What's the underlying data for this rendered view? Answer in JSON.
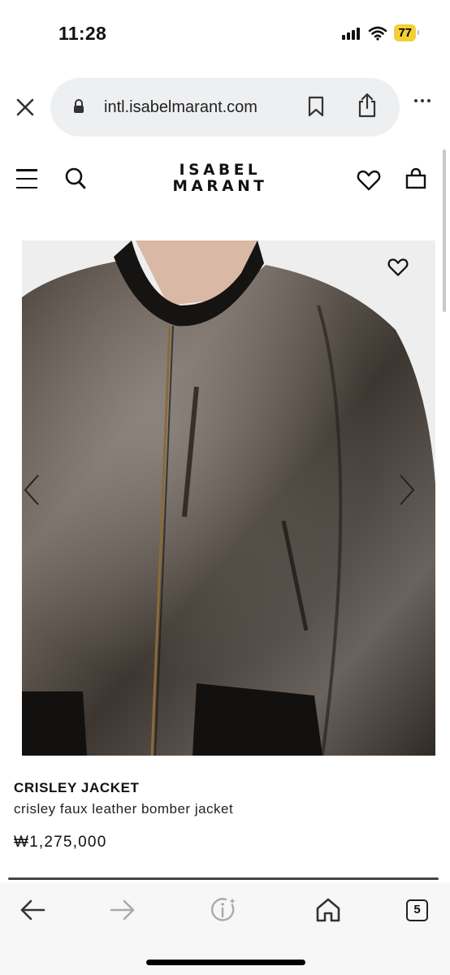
{
  "status_bar": {
    "time": "11:28",
    "battery": "77"
  },
  "browser": {
    "url": "intl.isabelmarant.com",
    "tab_count": "5"
  },
  "site": {
    "logo_line1": "ISABEL",
    "logo_line2": "MARANT"
  },
  "product": {
    "name": "CRISLEY JACKET",
    "description": "crisley faux leather bomber jacket",
    "price": "₩1,275,000"
  },
  "icons": [
    "close-icon",
    "lock-icon",
    "bookmark-icon",
    "share-icon",
    "more-icon",
    "menu-icon",
    "search-icon",
    "heart-icon",
    "bag-icon",
    "chevron-left-icon",
    "chevron-right-icon",
    "back-arrow-icon",
    "forward-arrow-icon",
    "info-icon",
    "home-icon",
    "tabs-icon"
  ],
  "colors": {
    "battery": "#f2cf36",
    "url_bar": "#eeeff1",
    "toolbar": "#f7f7f7",
    "text": "#111111"
  }
}
